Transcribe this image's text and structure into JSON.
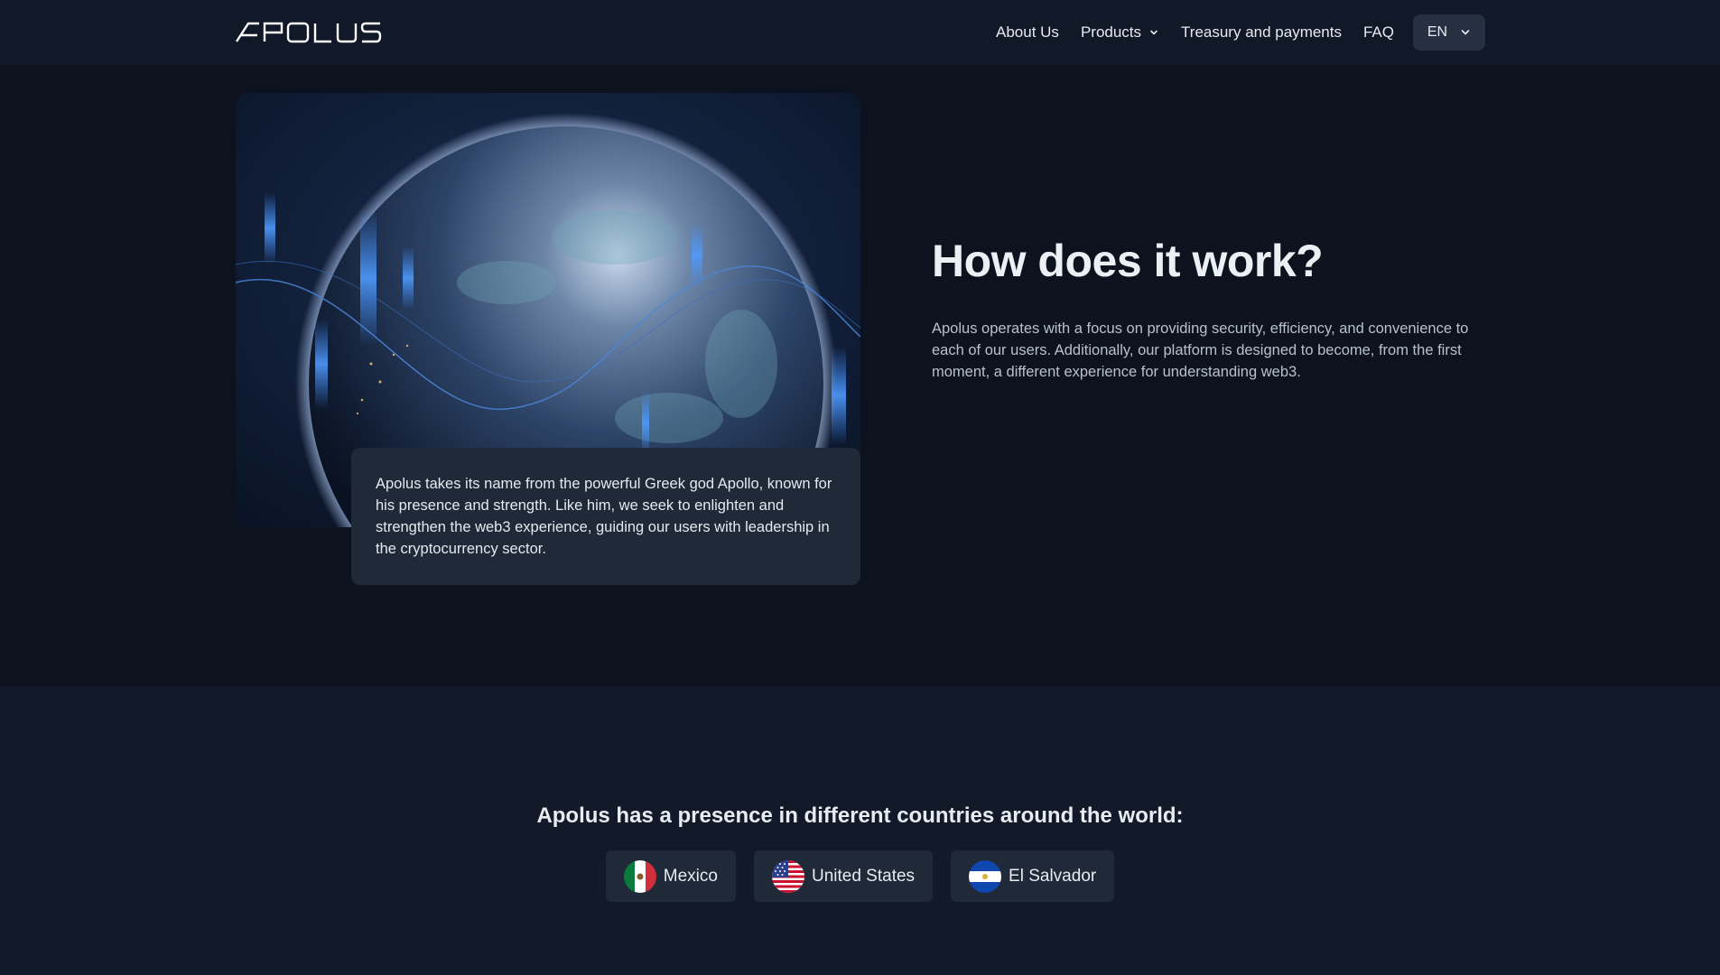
{
  "header": {
    "logo_text": "APOLUS",
    "nav": {
      "about": "About Us",
      "products": "Products",
      "treasury": "Treasury and payments",
      "faq": "FAQ"
    },
    "language": "EN"
  },
  "hero": {
    "image_icon": "earth-globe-image",
    "quote": "Apolus takes its name from the powerful Greek god Apollo, known for his presence and strength. Like him, we seek to enlighten and strengthen the web3 experience, guiding our users with leadership in the cryptocurrency sector.",
    "title": "How does it work?",
    "description": "Apolus operates with a focus on providing security, efficiency, and convenience to each of our users. Additionally, our platform is designed to become, from the first moment, a different experience for understanding web3."
  },
  "presence": {
    "title": "Apolus has a presence in different countries around the world:",
    "countries": [
      {
        "name": "Mexico",
        "flag_icon": "mexico-flag-icon"
      },
      {
        "name": "United States",
        "flag_icon": "usa-flag-icon"
      },
      {
        "name": "El Salvador",
        "flag_icon": "el-salvador-flag-icon"
      }
    ]
  },
  "colors": {
    "page_bg": "#0d131e",
    "header_bg": "#111827",
    "card_bg": "#1f2937",
    "section_bg": "#121a29"
  }
}
